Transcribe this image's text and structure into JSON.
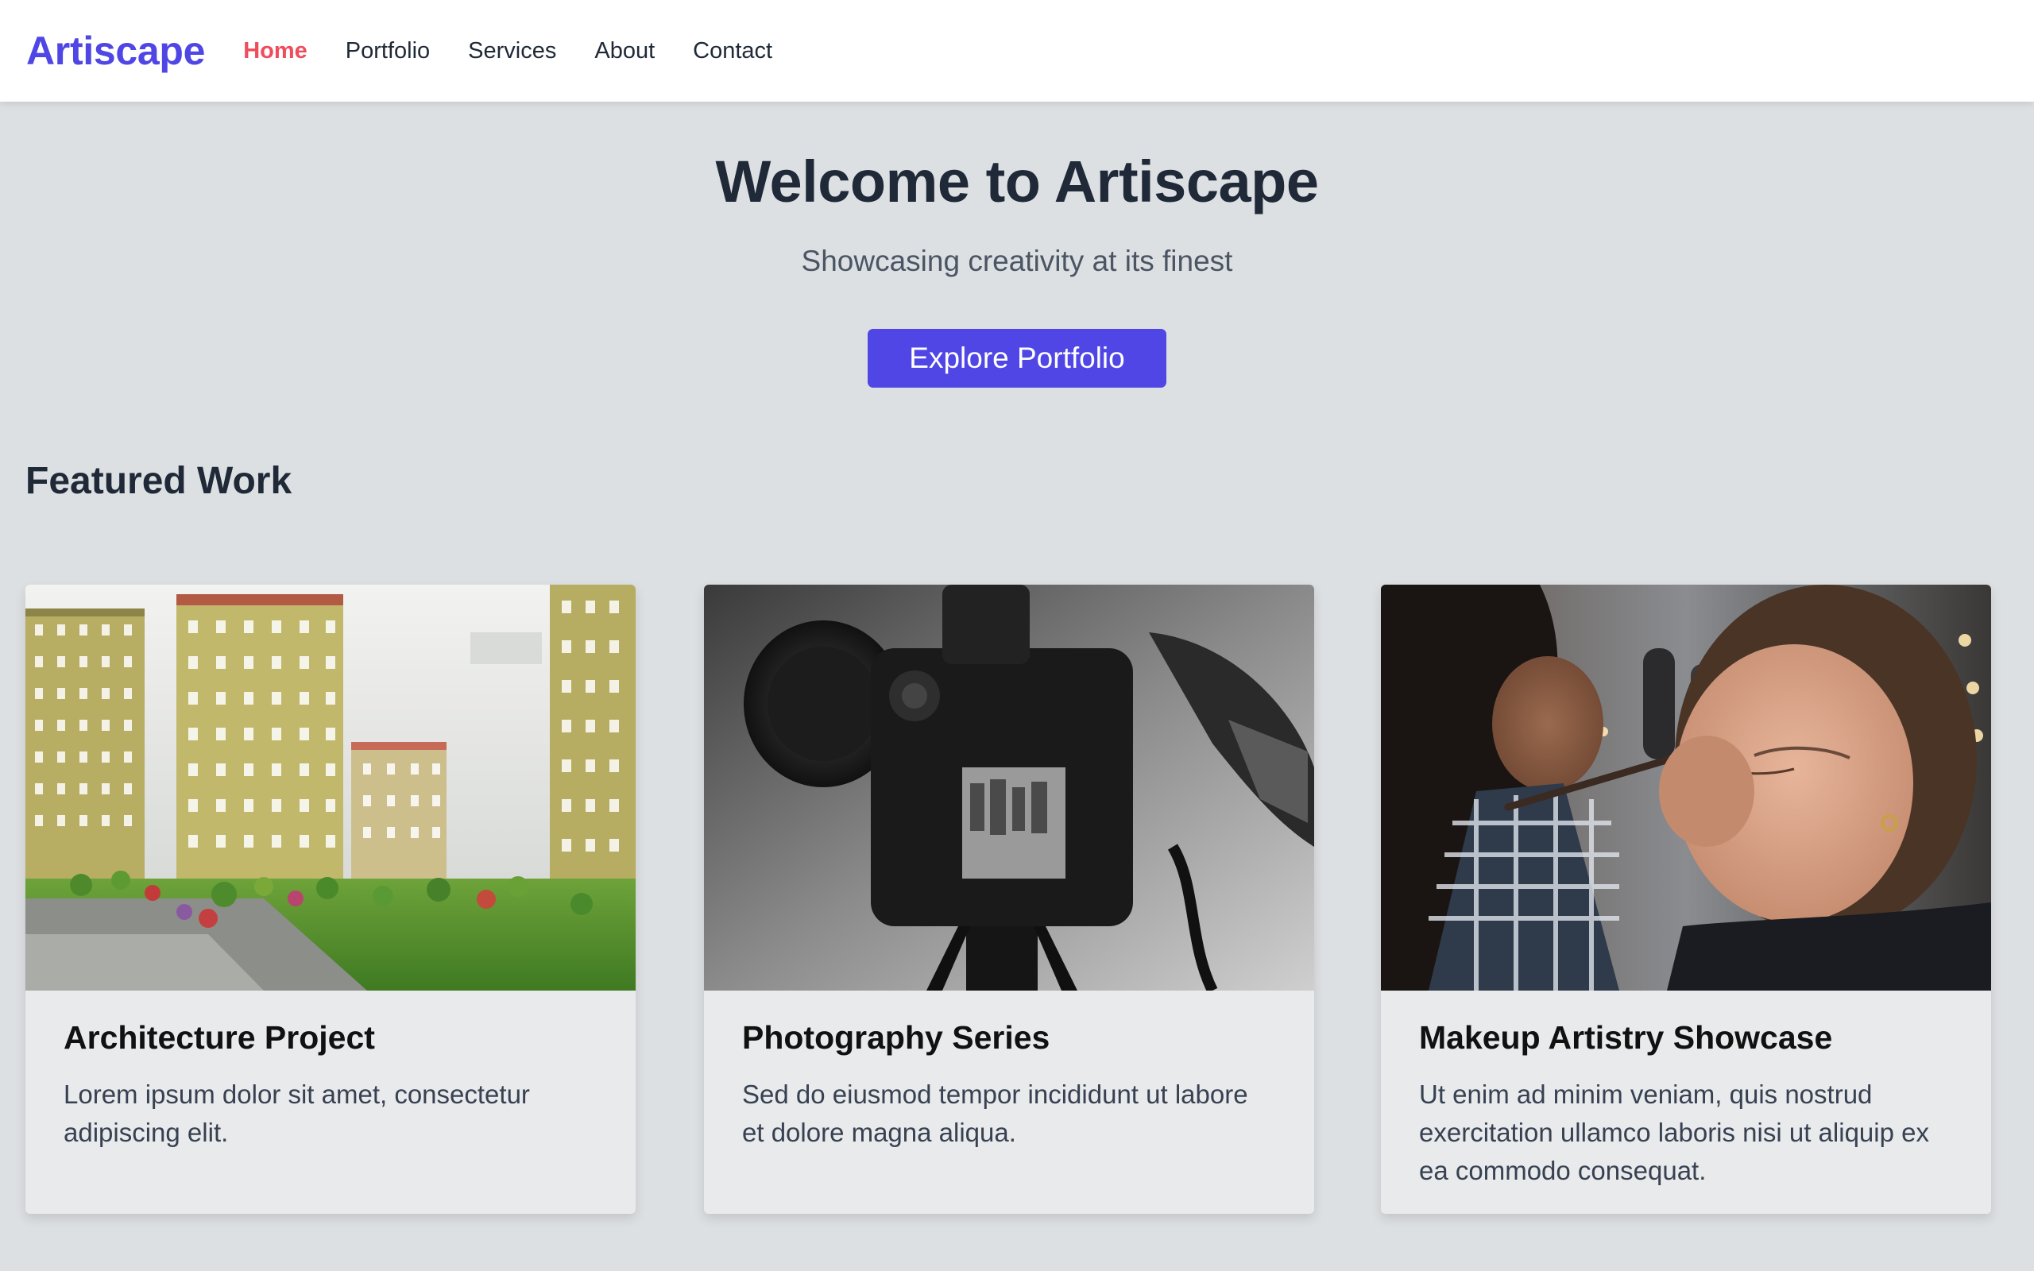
{
  "header": {
    "logo": "Artiscape",
    "nav": [
      {
        "label": "Home",
        "active": true
      },
      {
        "label": "Portfolio",
        "active": false
      },
      {
        "label": "Services",
        "active": false
      },
      {
        "label": "About",
        "active": false
      },
      {
        "label": "Contact",
        "active": false
      }
    ]
  },
  "hero": {
    "title": "Welcome to Artiscape",
    "subtitle": "Showcasing creativity at its finest",
    "cta_label": "Explore Portfolio"
  },
  "featured": {
    "title": "Featured Work",
    "cards": [
      {
        "title": "Architecture Project",
        "text": "Lorem ipsum dolor sit amet, consectetur adipiscing elit.",
        "image": "architecture-model-photo"
      },
      {
        "title": "Photography Series",
        "text": "Sed do eiusmod tempor incididunt ut labore et dolore magna aliqua.",
        "image": "camera-photo"
      },
      {
        "title": "Makeup Artistry Showcase",
        "text": "Ut enim ad minim veniam, quis nostrud exercitation ullamco laboris nisi ut aliquip ex ea commodo consequat.",
        "image": "makeup-artist-photo"
      }
    ]
  },
  "colors": {
    "brand": "#4f46e5",
    "nav_active": "#ef4c5c",
    "page_bg": "#dde0e3"
  }
}
